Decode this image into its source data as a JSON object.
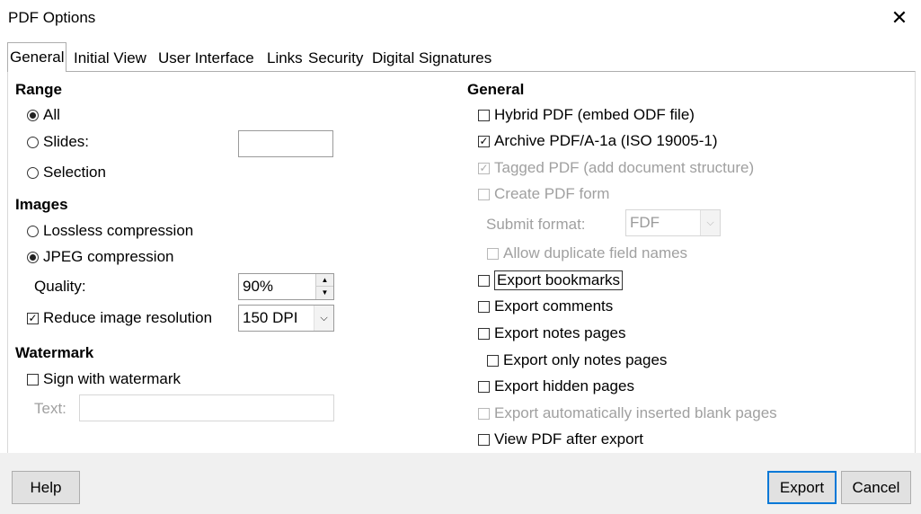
{
  "window": {
    "title": "PDF Options"
  },
  "tabs": [
    {
      "label": "General"
    },
    {
      "label": "Initial View"
    },
    {
      "label": "User Interface"
    },
    {
      "label": "Links"
    },
    {
      "label": "Security"
    },
    {
      "label": "Digital Signatures"
    }
  ],
  "range": {
    "heading": "Range",
    "all": "All",
    "slides": "Slides:",
    "slides_value": "",
    "selection": "Selection"
  },
  "images": {
    "heading": "Images",
    "lossless": "Lossless compression",
    "jpeg": "JPEG compression",
    "quality_label": "Quality:",
    "quality_value": "90%",
    "reduce": "Reduce image resolution",
    "resolution": "150 DPI"
  },
  "watermark": {
    "heading": "Watermark",
    "sign": "Sign with watermark",
    "text_label": "Text:",
    "text_value": ""
  },
  "general": {
    "heading": "General",
    "hybrid": "Hybrid PDF (embed ODF file)",
    "archive": "Archive PDF/A-1a (ISO 19005-1)",
    "tagged": "Tagged PDF (add document structure)",
    "create_form": "Create PDF form",
    "submit_label": "Submit format:",
    "submit_value": "FDF",
    "allow_dup": "Allow duplicate field names",
    "bookmarks": "Export bookmarks",
    "comments": "Export comments",
    "notes": "Export notes pages",
    "only_notes": "Export only notes pages",
    "hidden": "Export hidden pages",
    "blank": "Export automatically inserted blank pages",
    "view_after": "View PDF after export"
  },
  "footer": {
    "help": "Help",
    "export": "Export",
    "cancel": "Cancel"
  },
  "states": {
    "range": "All",
    "image_compression": "JPEG compression",
    "reduce_image_resolution": true,
    "sign_with_watermark": false,
    "hybrid": false,
    "archive": true,
    "tagged": true,
    "create_form": false,
    "allow_dup": false,
    "bookmarks": false,
    "comments": false,
    "notes": false,
    "only_notes": false,
    "hidden": false,
    "blank": false,
    "view_after": false
  },
  "icons": {
    "close": "close-icon",
    "dropdown": "chevron-down-icon",
    "spin_up": "spin-up-icon",
    "spin_down": "spin-down-icon"
  },
  "colors": {
    "accent": "#0078d7",
    "footer_bg": "#f0f0f0",
    "disabled_text": "#a0a0a0"
  }
}
